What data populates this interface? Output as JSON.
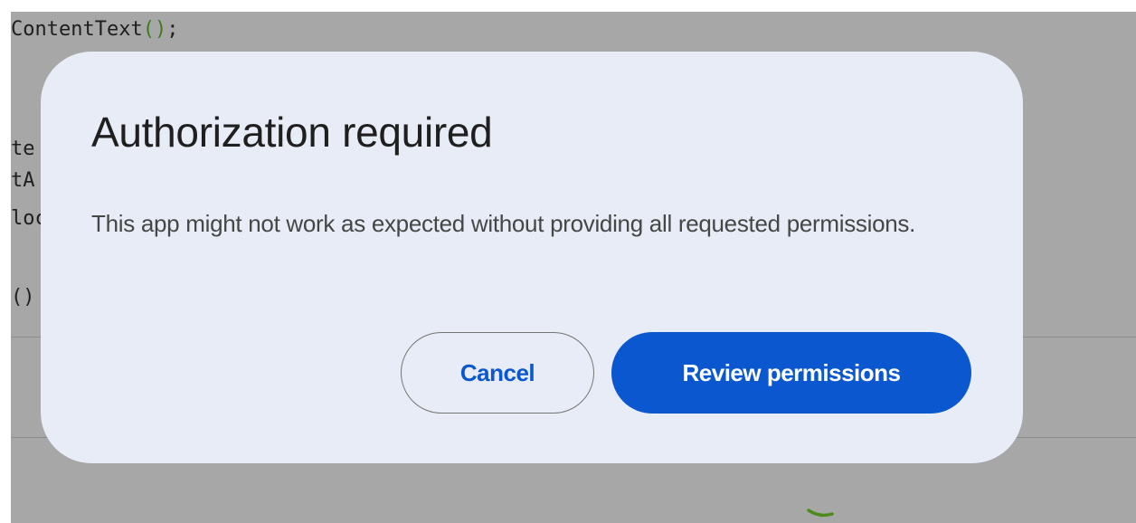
{
  "editor": {
    "line1": {
      "text": "ContentText",
      "paren": "()",
      "tail": ";"
    },
    "line2": "te",
    "line3": "tA",
    "line4": "loc",
    "line5": "()"
  },
  "dialog": {
    "title": "Authorization required",
    "body": "This app might not work as expected without providing all requested permissions.",
    "cancel_label": "Cancel",
    "primary_label": "Review permissions"
  },
  "colors": {
    "dialog_bg": "#e8ecf6",
    "primary_button": "#0b57d0",
    "scrim": "#a7a7a7"
  }
}
